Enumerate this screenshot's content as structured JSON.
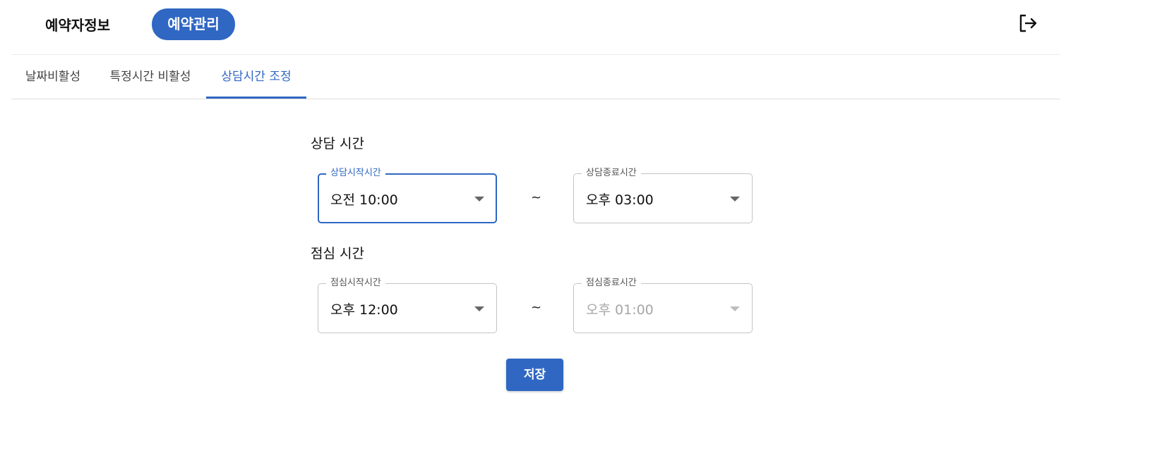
{
  "header": {
    "nav": [
      {
        "label": "예약자정보",
        "active": false
      },
      {
        "label": "예약관리",
        "active": true
      }
    ],
    "logout_icon": "logout-icon"
  },
  "tabs": [
    {
      "label": "날짜비활성",
      "active": false
    },
    {
      "label": "특정시간 비활성",
      "active": false
    },
    {
      "label": "상담시간 조정",
      "active": true
    }
  ],
  "consult": {
    "title": "상담 시간",
    "start": {
      "label": "상담시작시간",
      "value": "오전 10:00"
    },
    "separator": "~",
    "end": {
      "label": "상담종료시간",
      "value": "오후 03:00"
    }
  },
  "lunch": {
    "title": "점심 시간",
    "start": {
      "label": "점심시작시간",
      "value": "오후 12:00"
    },
    "separator": "~",
    "end": {
      "label": "점심종료시간",
      "value": "오후 01:00"
    }
  },
  "save_label": "저장",
  "colors": {
    "accent": "#2f67c3",
    "disabled_text": "#a6a6a6"
  }
}
